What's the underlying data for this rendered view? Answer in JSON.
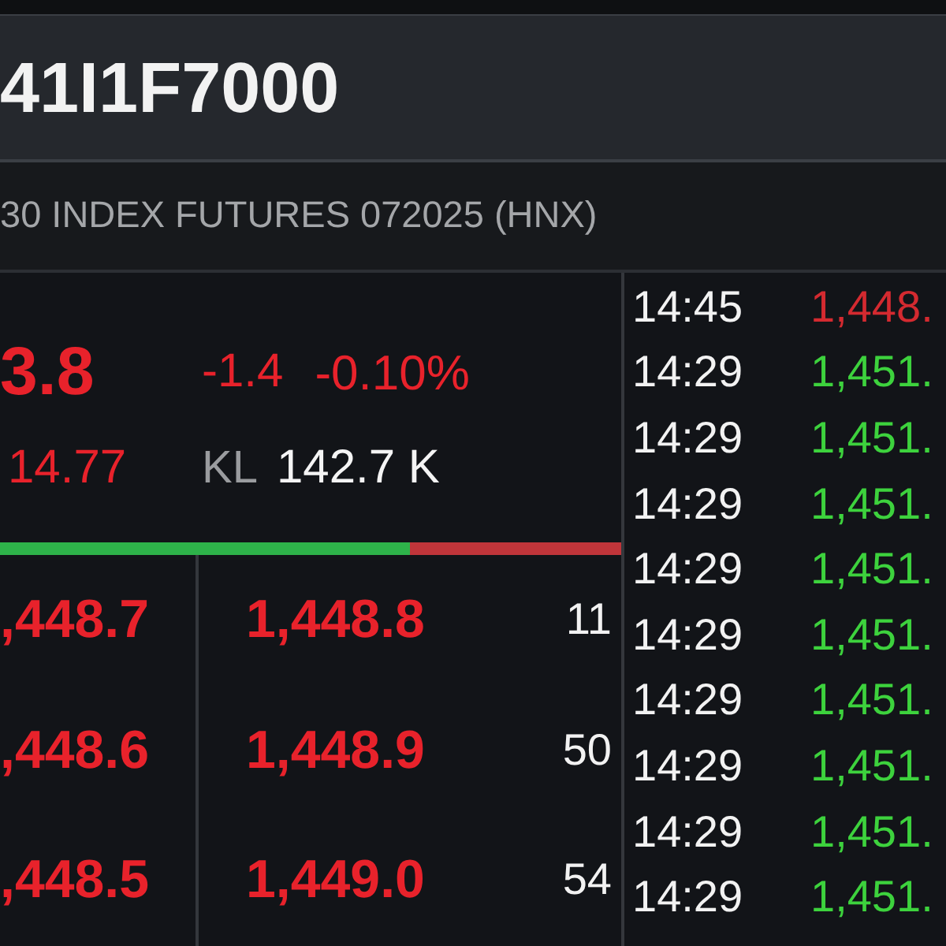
{
  "header": {
    "symbol": "41I1F7000",
    "contract_name": "30 INDEX FUTURES 072025 (HNX)"
  },
  "quote": {
    "last_price": "3.8",
    "change": "-1.4",
    "change_percent": "-0.10%",
    "second_price": "14.77",
    "volume_label": "KL",
    "volume": "142.7 K"
  },
  "buy_sell_bar": {
    "level": 0.66
  },
  "order_book": [
    {
      "bid_price": ",448.7",
      "ask_price": "1,448.8",
      "ask_volume": "11"
    },
    {
      "bid_price": ",448.6",
      "ask_price": "1,448.9",
      "ask_volume": "50"
    },
    {
      "bid_price": ",448.5",
      "ask_price": "1,449.0",
      "ask_volume": "54"
    }
  ],
  "trades": [
    {
      "time": "14:45",
      "price": "1,448.",
      "color": "#d42a30"
    },
    {
      "time": "14:29",
      "price": "1,451.",
      "color": "#3dd23d"
    },
    {
      "time": "14:29",
      "price": "1,451.",
      "color": "#3dd23d"
    },
    {
      "time": "14:29",
      "price": "1,451.",
      "color": "#3dd23d"
    },
    {
      "time": "14:29",
      "price": "1,451.",
      "color": "#3dd23d"
    },
    {
      "time": "14:29",
      "price": "1,451.",
      "color": "#3dd23d"
    },
    {
      "time": "14:29",
      "price": "1,451.",
      "color": "#3dd23d"
    },
    {
      "time": "14:29",
      "price": "1,451.",
      "color": "#3dd23d"
    },
    {
      "time": "14:29",
      "price": "1,451.",
      "color": "#3dd23d"
    },
    {
      "time": "14:29",
      "price": "1,451.",
      "color": "#3dd23d"
    }
  ]
}
